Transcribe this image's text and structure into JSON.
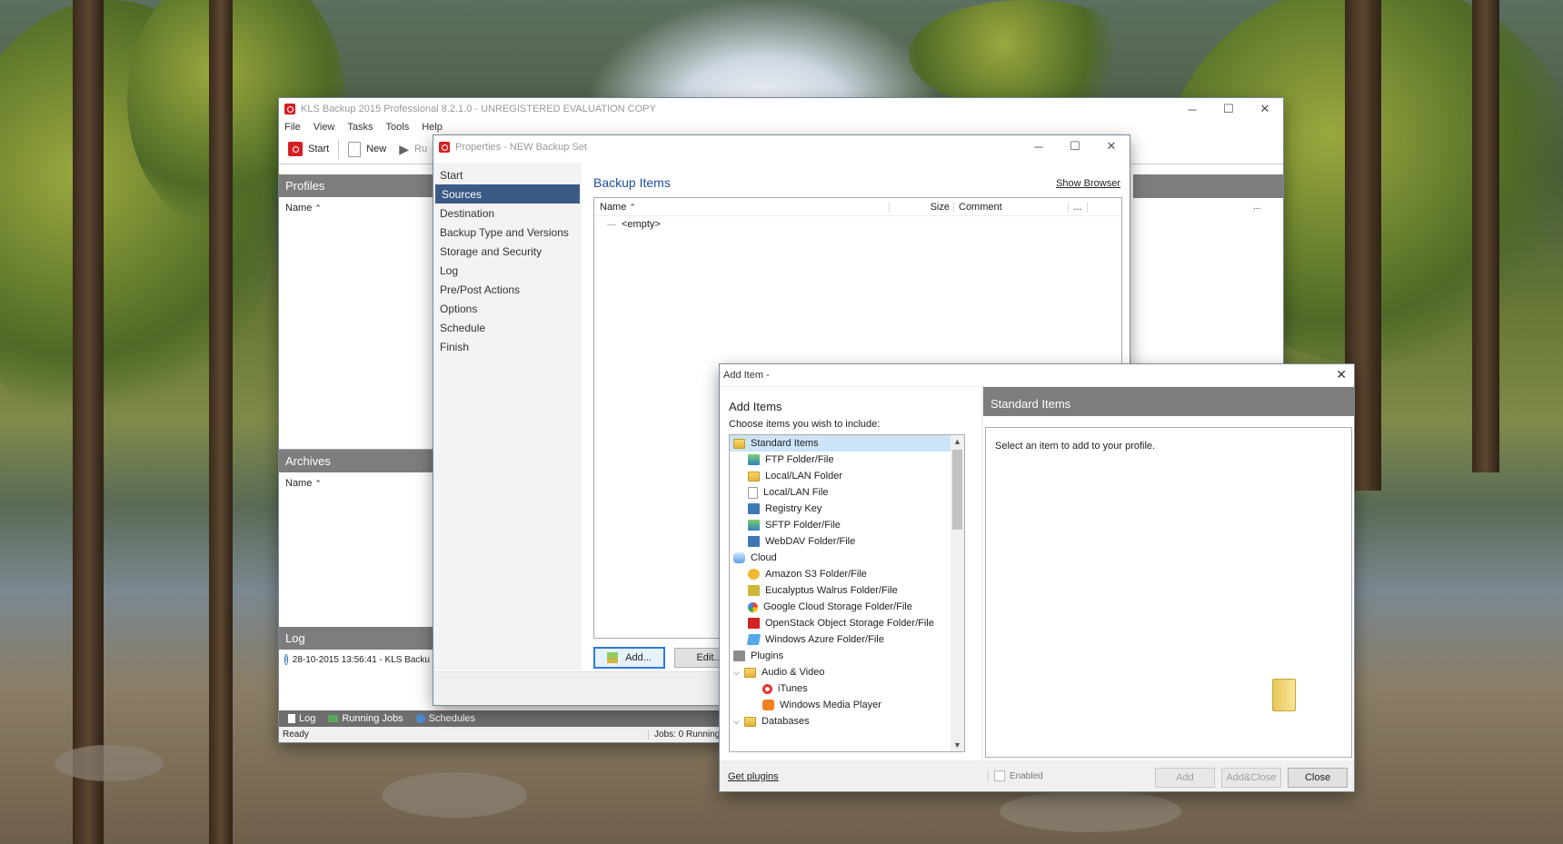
{
  "main_window": {
    "title": "KLS Backup 2015 Professional 8.2.1.0 - UNREGISTERED EVALUATION COPY",
    "menu": [
      "File",
      "View",
      "Tasks",
      "Tools",
      "Help"
    ],
    "toolbar": {
      "start": "Start",
      "new": "New",
      "run": "Ru"
    },
    "profiles": {
      "header": "Profiles",
      "col_name": "Name"
    },
    "archives": {
      "header": "Archives",
      "col_name": "Name"
    },
    "log": {
      "header": "Log",
      "entry": "28-10-2015 13:56:41 - KLS Backu"
    },
    "bottom_tabs": [
      "Log",
      "Running Jobs",
      "Schedules"
    ],
    "status": {
      "left": "Ready",
      "right": "Jobs: 0 Running,"
    },
    "right_ellipsis": "..."
  },
  "properties_window": {
    "title": "Properties - NEW Backup Set",
    "nav": [
      "Start",
      "Sources",
      "Destination",
      "Backup Type and Versions",
      "Storage and Security",
      "Log",
      "Pre/Post Actions",
      "Options",
      "Schedule",
      "Finish"
    ],
    "selected_nav": "Sources",
    "section_title": "Backup Items",
    "show_browser": "Show Browser",
    "columns": {
      "name": "Name",
      "size": "Size",
      "comment": "Comment",
      "more": "..."
    },
    "empty_text": "<empty>",
    "add_button": "Add...",
    "edit_button": "Edit..."
  },
  "add_item_dialog": {
    "title": "Add Item -",
    "heading": "Add Items",
    "subheading": "Choose items you wish to include:",
    "tree": {
      "standard": {
        "label": "Standard Items",
        "children": [
          "FTP Folder/File",
          "Local/LAN Folder",
          "Local/LAN File",
          "Registry Key",
          "SFTP Folder/File",
          "WebDAV Folder/File"
        ]
      },
      "cloud": {
        "label": "Cloud",
        "children": [
          "Amazon S3 Folder/File",
          "Eucalyptus Walrus Folder/File",
          "Google Cloud Storage Folder/File",
          "OpenStack Object Storage Folder/File",
          "Windows Azure Folder/File"
        ]
      },
      "plugins": {
        "label": "Plugins",
        "audio_video": {
          "label": "Audio & Video",
          "children": [
            "iTunes",
            "Windows Media Player"
          ]
        },
        "databases": "Databases"
      }
    },
    "right_panel_header": "Standard Items",
    "right_panel_text": "Select an item to add to your profile.",
    "get_plugins": "Get plugins",
    "enabled_label": "Enabled",
    "buttons": {
      "add": "Add",
      "add_close": "Add&Close",
      "close": "Close"
    }
  },
  "colors": {
    "accent": "#3b5a86",
    "header_gray": "#7d7d7d",
    "link_blue": "#1f4e9c"
  }
}
